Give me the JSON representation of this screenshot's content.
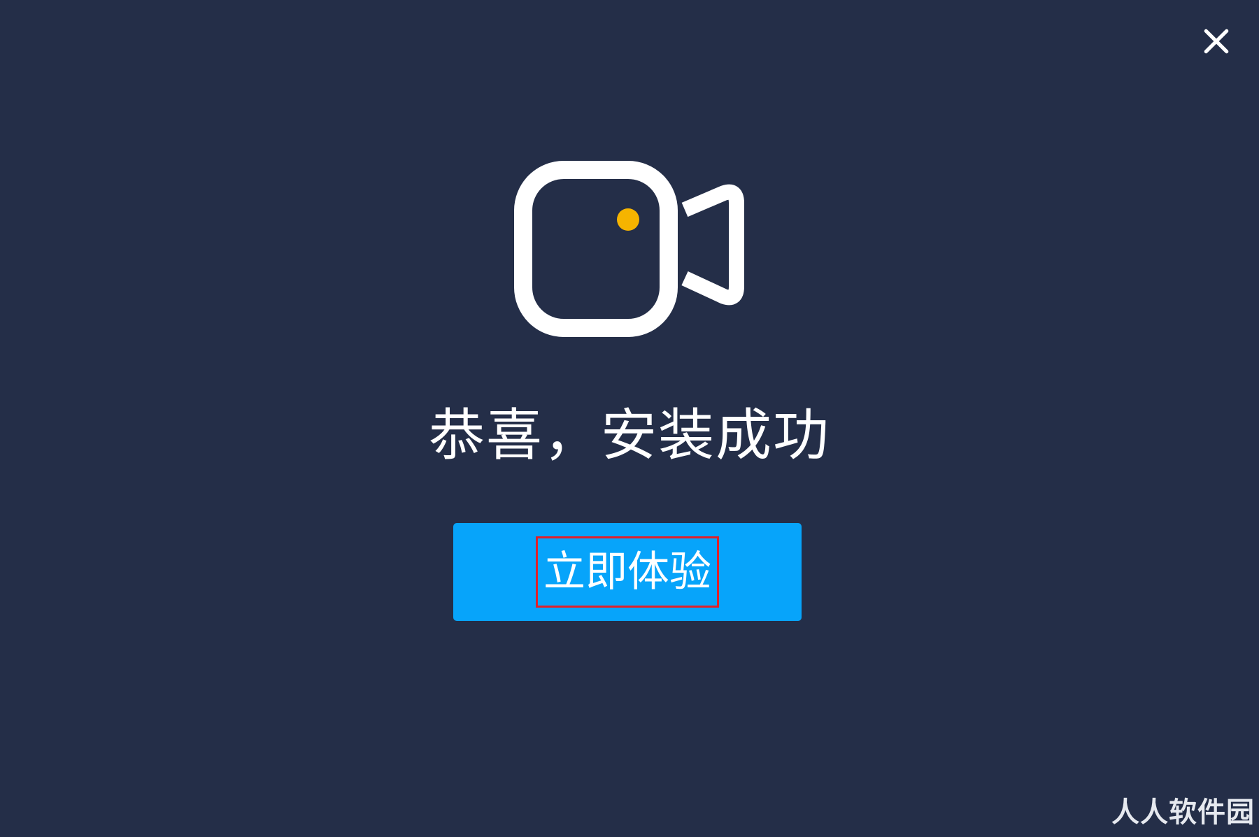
{
  "dialog": {
    "title": "恭喜，安装成功",
    "primary_button_label": "立即体验",
    "close_icon": "close-icon",
    "logo_icon": "video-camera-icon"
  },
  "watermark": {
    "text": "人人软件园"
  },
  "colors": {
    "background": "#242e48",
    "button": "#07a4fa",
    "logo_stroke": "#ffffff",
    "logo_dot": "#f6b400",
    "highlight_box": "#e0202a"
  }
}
